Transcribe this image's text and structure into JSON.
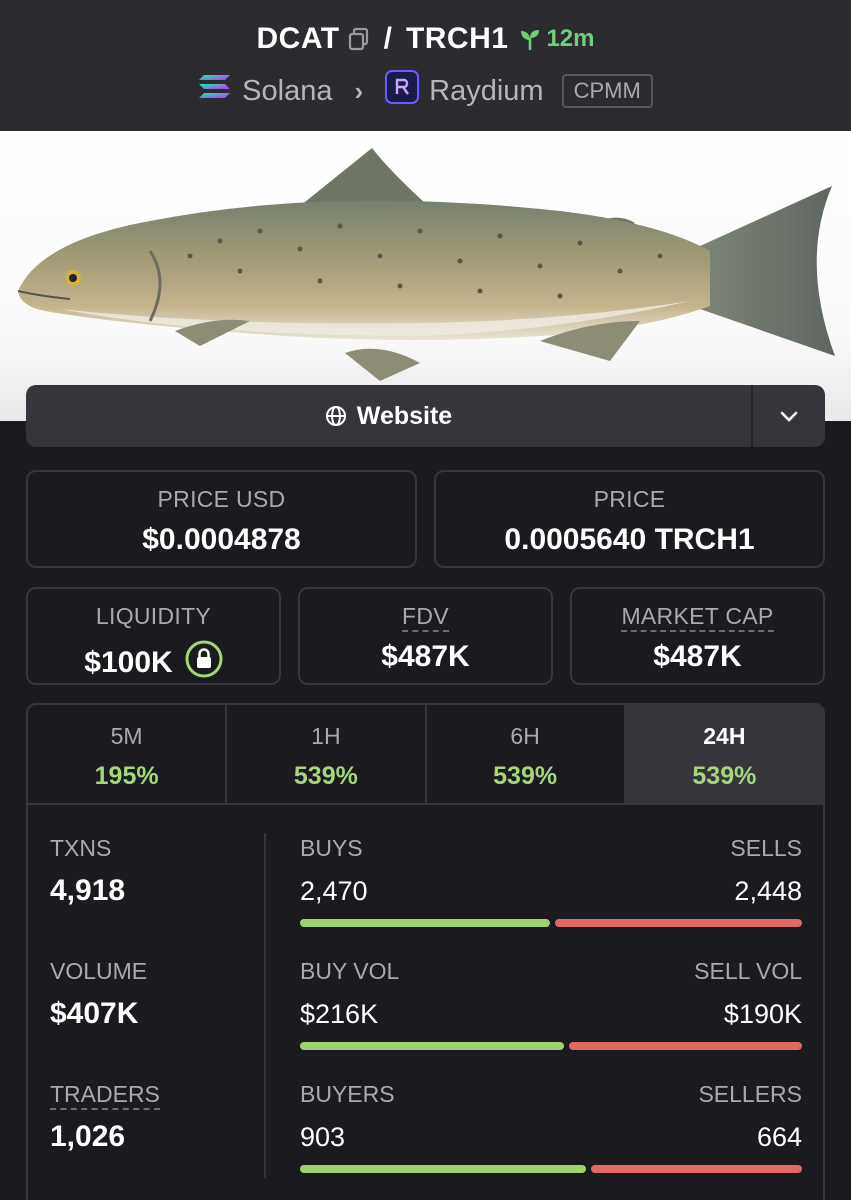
{
  "header": {
    "base_token": "DCAT",
    "quote_token": "TRCH1",
    "separator": "/",
    "age": "12m",
    "chain": "Solana",
    "dex": "Raydium",
    "pool_type": "CPMM"
  },
  "website": {
    "label": "Website"
  },
  "prices": {
    "usd_label": "PRICE USD",
    "usd_value": "$0.0004878",
    "native_label": "PRICE",
    "native_value": "0.0005640 TRCH1"
  },
  "metrics": {
    "liquidity_label": "LIQUIDITY",
    "liquidity_value": "$100K",
    "fdv_label": "FDV",
    "fdv_value": "$487K",
    "mcap_label": "MARKET CAP",
    "mcap_value": "$487K"
  },
  "tabs": [
    {
      "label": "5M",
      "value": "195%"
    },
    {
      "label": "1H",
      "value": "539%"
    },
    {
      "label": "6H",
      "value": "539%"
    },
    {
      "label": "24H",
      "value": "539%",
      "active": true
    }
  ],
  "stats": {
    "txns_label": "TXNS",
    "txns_value": "4,918",
    "volume_label": "VOLUME",
    "volume_value": "$407K",
    "traders_label": "TRADERS",
    "traders_value": "1,026",
    "buys_label": "BUYS",
    "buys_value": "2,470",
    "sells_label": "SELLS",
    "sells_value": "2,448",
    "buyvol_label": "BUY VOL",
    "buyvol_value": "$216K",
    "sellvol_label": "SELL VOL",
    "sellvol_value": "$190K",
    "buyers_label": "BUYERS",
    "buyers_value": "903",
    "sellers_label": "SELLERS",
    "sellers_value": "664"
  },
  "colors": {
    "positive": "#a4d67c",
    "buy_bar": "#9dd26d",
    "sell_bar": "#e26863",
    "age": "#6fd07a"
  }
}
